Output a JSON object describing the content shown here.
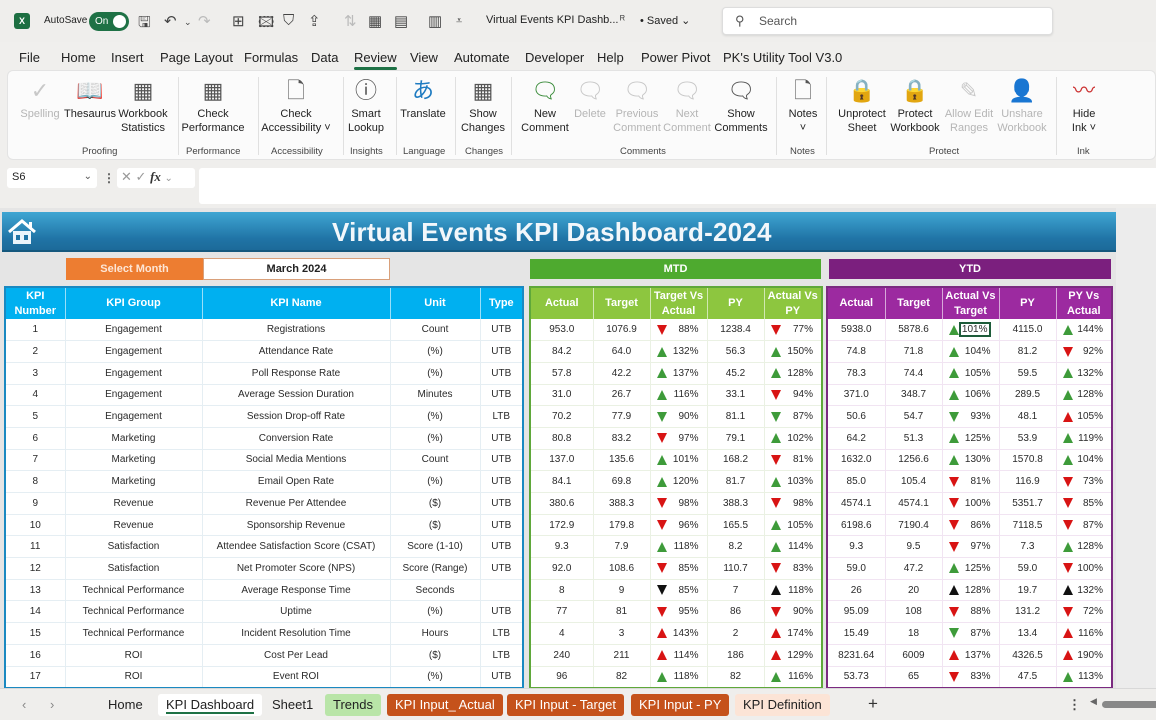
{
  "titlebar": {
    "app_icon": "excel-icon",
    "autosave_label": "AutoSave",
    "autosave_state": "On",
    "doc_title": "Virtual Events KPI Dashb...",
    "saved_status": "• Saved",
    "search_placeholder": "Search"
  },
  "menu": [
    "File",
    "Home",
    "Insert",
    "Page Layout",
    "Formulas",
    "Data",
    "Review",
    "View",
    "Automate",
    "Developer",
    "Help",
    "Power Pivot",
    "PK's Utility Tool V3.0"
  ],
  "menu_active": "Review",
  "ribbon": {
    "buttons": [
      {
        "l1": "Spelling",
        "l2": "",
        "icon": "spelling-icon",
        "disabled": true
      },
      {
        "l1": "Thesaurus",
        "l2": "",
        "icon": "thesaurus-icon",
        "disabled": false
      },
      {
        "l1": "Workbook",
        "l2": "Statistics",
        "icon": "workbook-statistics-icon",
        "disabled": false
      },
      {
        "l1": "Check",
        "l2": "Performance",
        "icon": "check-performance-icon",
        "disabled": false
      },
      {
        "l1": "Check",
        "l2": "Accessibility ˅",
        "icon": "check-accessibility-icon",
        "disabled": false
      },
      {
        "l1": "Smart",
        "l2": "Lookup",
        "icon": "smart-lookup-icon",
        "disabled": false
      },
      {
        "l1": "Translate",
        "l2": "",
        "icon": "translate-icon",
        "disabled": false
      },
      {
        "l1": "Show",
        "l2": "Changes",
        "icon": "show-changes-icon",
        "disabled": false
      },
      {
        "l1": "New",
        "l2": "Comment",
        "icon": "new-comment-icon",
        "disabled": false
      },
      {
        "l1": "Delete",
        "l2": "",
        "icon": "delete-comment-icon",
        "disabled": true
      },
      {
        "l1": "Previous",
        "l2": "Comment",
        "icon": "previous-comment-icon",
        "disabled": true
      },
      {
        "l1": "Next",
        "l2": "Comment",
        "icon": "next-comment-icon",
        "disabled": true
      },
      {
        "l1": "Show",
        "l2": "Comments",
        "icon": "show-comments-icon",
        "disabled": false
      },
      {
        "l1": "Notes",
        "l2": "˅",
        "icon": "notes-icon",
        "disabled": false
      },
      {
        "l1": "Unprotect",
        "l2": "Sheet",
        "icon": "unprotect-sheet-icon",
        "disabled": false
      },
      {
        "l1": "Protect",
        "l2": "Workbook",
        "icon": "protect-workbook-icon",
        "disabled": false
      },
      {
        "l1": "Allow Edit",
        "l2": "Ranges",
        "icon": "allow-edit-ranges-icon",
        "disabled": true
      },
      {
        "l1": "Unshare",
        "l2": "Workbook",
        "icon": "unshare-workbook-icon",
        "disabled": true
      },
      {
        "l1": "Hide",
        "l2": "Ink ˅",
        "icon": "hide-ink-icon",
        "disabled": false
      }
    ],
    "groups": [
      "Proofing",
      "Performance",
      "Accessibility",
      "Insights",
      "Language",
      "Changes",
      "Comments",
      "Notes",
      "Protect",
      "Ink"
    ]
  },
  "formula_bar": {
    "name_box": "S6",
    "formula": ""
  },
  "dashboard": {
    "title": "Virtual Events KPI Dashboard-2024",
    "select_month_label": "Select Month",
    "selected_month": "March 2024",
    "mtd_label": "MTD",
    "ytd_label": "YTD",
    "left_headers": [
      "KPI Number",
      "KPI Group",
      "KPI Name",
      "Unit",
      "Type"
    ],
    "mtd_headers": [
      "Actual",
      "Target",
      "Target Vs Actual",
      "PY",
      "Actual Vs PY"
    ],
    "ytd_headers": [
      "Actual",
      "Target",
      "Actual Vs Target",
      "PY",
      "PY Vs Actual"
    ],
    "colors": {
      "green": "#3e9b3a",
      "red": "#d81414",
      "black": "#111111",
      "banner": "#2074a6",
      "mtd": "#5fa83a",
      "ytd": "#7b2a80",
      "left": "#00b0f0",
      "select": "#ed7d31"
    },
    "rows": [
      {
        "n": "1",
        "group": "Engagement",
        "name": "Registrations",
        "unit": "Count",
        "type": "UTB",
        "mtd": {
          "actual": "953.0",
          "target": "1076.9",
          "tva": {
            "v": "88%",
            "dir": "down",
            "c": "red"
          },
          "py": "1238.4",
          "avp": {
            "v": "77%",
            "dir": "down",
            "c": "red"
          }
        },
        "ytd": {
          "actual": "5938.0",
          "target": "5878.6",
          "avt": {
            "v": "101%",
            "dir": "up",
            "c": "green"
          },
          "py": "4115.0",
          "pva": {
            "v": "144%",
            "dir": "up",
            "c": "green"
          }
        }
      },
      {
        "n": "2",
        "group": "Engagement",
        "name": "Attendance Rate",
        "unit": "(%)",
        "type": "UTB",
        "mtd": {
          "actual": "84.2",
          "target": "64.0",
          "tva": {
            "v": "132%",
            "dir": "up",
            "c": "green"
          },
          "py": "56.3",
          "avp": {
            "v": "150%",
            "dir": "up",
            "c": "green"
          }
        },
        "ytd": {
          "actual": "74.8",
          "target": "71.8",
          "avt": {
            "v": "104%",
            "dir": "up",
            "c": "green"
          },
          "py": "81.2",
          "pva": {
            "v": "92%",
            "dir": "down",
            "c": "red"
          }
        }
      },
      {
        "n": "3",
        "group": "Engagement",
        "name": "Poll Response Rate",
        "unit": "(%)",
        "type": "UTB",
        "mtd": {
          "actual": "57.8",
          "target": "42.2",
          "tva": {
            "v": "137%",
            "dir": "up",
            "c": "green"
          },
          "py": "45.2",
          "avp": {
            "v": "128%",
            "dir": "up",
            "c": "green"
          }
        },
        "ytd": {
          "actual": "78.3",
          "target": "74.4",
          "avt": {
            "v": "105%",
            "dir": "up",
            "c": "green"
          },
          "py": "59.5",
          "pva": {
            "v": "132%",
            "dir": "up",
            "c": "green"
          }
        }
      },
      {
        "n": "4",
        "group": "Engagement",
        "name": "Average Session Duration",
        "unit": "Minutes",
        "type": "UTB",
        "mtd": {
          "actual": "31.0",
          "target": "26.7",
          "tva": {
            "v": "116%",
            "dir": "up",
            "c": "green"
          },
          "py": "33.1",
          "avp": {
            "v": "94%",
            "dir": "down",
            "c": "red"
          }
        },
        "ytd": {
          "actual": "371.0",
          "target": "348.7",
          "avt": {
            "v": "106%",
            "dir": "up",
            "c": "green"
          },
          "py": "289.5",
          "pva": {
            "v": "128%",
            "dir": "up",
            "c": "green"
          }
        }
      },
      {
        "n": "5",
        "group": "Engagement",
        "name": "Session Drop-off Rate",
        "unit": "(%)",
        "type": "LTB",
        "mtd": {
          "actual": "70.2",
          "target": "77.9",
          "tva": {
            "v": "90%",
            "dir": "down",
            "c": "green"
          },
          "py": "81.1",
          "avp": {
            "v": "87%",
            "dir": "down",
            "c": "green"
          }
        },
        "ytd": {
          "actual": "50.6",
          "target": "54.7",
          "avt": {
            "v": "93%",
            "dir": "down",
            "c": "green"
          },
          "py": "48.1",
          "pva": {
            "v": "105%",
            "dir": "up",
            "c": "red"
          }
        }
      },
      {
        "n": "6",
        "group": "Marketing",
        "name": "Conversion Rate",
        "unit": "(%)",
        "type": "UTB",
        "mtd": {
          "actual": "80.8",
          "target": "83.2",
          "tva": {
            "v": "97%",
            "dir": "down",
            "c": "red"
          },
          "py": "79.1",
          "avp": {
            "v": "102%",
            "dir": "up",
            "c": "green"
          }
        },
        "ytd": {
          "actual": "64.2",
          "target": "51.3",
          "avt": {
            "v": "125%",
            "dir": "up",
            "c": "green"
          },
          "py": "53.9",
          "pva": {
            "v": "119%",
            "dir": "up",
            "c": "green"
          }
        }
      },
      {
        "n": "7",
        "group": "Marketing",
        "name": "Social Media Mentions",
        "unit": "Count",
        "type": "UTB",
        "mtd": {
          "actual": "137.0",
          "target": "135.6",
          "tva": {
            "v": "101%",
            "dir": "up",
            "c": "green"
          },
          "py": "168.2",
          "avp": {
            "v": "81%",
            "dir": "down",
            "c": "red"
          }
        },
        "ytd": {
          "actual": "1632.0",
          "target": "1256.6",
          "avt": {
            "v": "130%",
            "dir": "up",
            "c": "green"
          },
          "py": "1570.8",
          "pva": {
            "v": "104%",
            "dir": "up",
            "c": "green"
          }
        }
      },
      {
        "n": "8",
        "group": "Marketing",
        "name": "Email Open Rate",
        "unit": "(%)",
        "type": "UTB",
        "mtd": {
          "actual": "84.1",
          "target": "69.8",
          "tva": {
            "v": "120%",
            "dir": "up",
            "c": "green"
          },
          "py": "81.7",
          "avp": {
            "v": "103%",
            "dir": "up",
            "c": "green"
          }
        },
        "ytd": {
          "actual": "85.0",
          "target": "105.4",
          "avt": {
            "v": "81%",
            "dir": "down",
            "c": "red"
          },
          "py": "116.9",
          "pva": {
            "v": "73%",
            "dir": "down",
            "c": "red"
          }
        }
      },
      {
        "n": "9",
        "group": "Revenue",
        "name": "Revenue Per Attendee",
        "unit": "($)",
        "type": "UTB",
        "mtd": {
          "actual": "380.6",
          "target": "388.3",
          "tva": {
            "v": "98%",
            "dir": "down",
            "c": "red"
          },
          "py": "388.3",
          "avp": {
            "v": "98%",
            "dir": "down",
            "c": "red"
          }
        },
        "ytd": {
          "actual": "4574.1",
          "target": "4574.1",
          "avt": {
            "v": "100%",
            "dir": "down",
            "c": "red"
          },
          "py": "5351.7",
          "pva": {
            "v": "85%",
            "dir": "down",
            "c": "red"
          }
        }
      },
      {
        "n": "10",
        "group": "Revenue",
        "name": "Sponsorship Revenue",
        "unit": "($)",
        "type": "UTB",
        "mtd": {
          "actual": "172.9",
          "target": "179.8",
          "tva": {
            "v": "96%",
            "dir": "down",
            "c": "red"
          },
          "py": "165.5",
          "avp": {
            "v": "105%",
            "dir": "up",
            "c": "green"
          }
        },
        "ytd": {
          "actual": "6198.6",
          "target": "7190.4",
          "avt": {
            "v": "86%",
            "dir": "down",
            "c": "red"
          },
          "py": "7118.5",
          "pva": {
            "v": "87%",
            "dir": "down",
            "c": "red"
          }
        }
      },
      {
        "n": "11",
        "group": "Satisfaction",
        "name": "Attendee Satisfaction Score (CSAT)",
        "unit": "Score (1-10)",
        "type": "UTB",
        "mtd": {
          "actual": "9.3",
          "target": "7.9",
          "tva": {
            "v": "118%",
            "dir": "up",
            "c": "green"
          },
          "py": "8.2",
          "avp": {
            "v": "114%",
            "dir": "up",
            "c": "green"
          }
        },
        "ytd": {
          "actual": "9.3",
          "target": "9.5",
          "avt": {
            "v": "97%",
            "dir": "down",
            "c": "red"
          },
          "py": "7.3",
          "pva": {
            "v": "128%",
            "dir": "up",
            "c": "green"
          }
        }
      },
      {
        "n": "12",
        "group": "Satisfaction",
        "name": "Net Promoter Score (NPS)",
        "unit": "Score (Range)",
        "type": "UTB",
        "mtd": {
          "actual": "92.0",
          "target": "108.6",
          "tva": {
            "v": "85%",
            "dir": "down",
            "c": "red"
          },
          "py": "110.7",
          "avp": {
            "v": "83%",
            "dir": "down",
            "c": "red"
          }
        },
        "ytd": {
          "actual": "59.0",
          "target": "47.2",
          "avt": {
            "v": "125%",
            "dir": "up",
            "c": "green"
          },
          "py": "59.0",
          "pva": {
            "v": "100%",
            "dir": "down",
            "c": "red"
          }
        }
      },
      {
        "n": "13",
        "group": "Technical Performance",
        "name": "Average Response Time",
        "unit": "Seconds",
        "type": "",
        "mtd": {
          "actual": "8",
          "target": "9",
          "tva": {
            "v": "85%",
            "dir": "down",
            "c": "black"
          },
          "py": "7",
          "avp": {
            "v": "118%",
            "dir": "up",
            "c": "black"
          }
        },
        "ytd": {
          "actual": "26",
          "target": "20",
          "avt": {
            "v": "128%",
            "dir": "up",
            "c": "black"
          },
          "py": "19.7",
          "pva": {
            "v": "132%",
            "dir": "up",
            "c": "black"
          }
        }
      },
      {
        "n": "14",
        "group": "Technical Performance",
        "name": "Uptime",
        "unit": "(%)",
        "type": "UTB",
        "mtd": {
          "actual": "77",
          "target": "81",
          "tva": {
            "v": "95%",
            "dir": "down",
            "c": "red"
          },
          "py": "86",
          "avp": {
            "v": "90%",
            "dir": "down",
            "c": "red"
          }
        },
        "ytd": {
          "actual": "95.09",
          "target": "108",
          "avt": {
            "v": "88%",
            "dir": "down",
            "c": "red"
          },
          "py": "131.2",
          "pva": {
            "v": "72%",
            "dir": "down",
            "c": "red"
          }
        }
      },
      {
        "n": "15",
        "group": "Technical Performance",
        "name": "Incident Resolution Time",
        "unit": "Hours",
        "type": "LTB",
        "mtd": {
          "actual": "4",
          "target": "3",
          "tva": {
            "v": "143%",
            "dir": "up",
            "c": "red"
          },
          "py": "2",
          "avp": {
            "v": "174%",
            "dir": "up",
            "c": "red"
          }
        },
        "ytd": {
          "actual": "15.49",
          "target": "18",
          "avt": {
            "v": "87%",
            "dir": "down",
            "c": "green"
          },
          "py": "13.4",
          "pva": {
            "v": "116%",
            "dir": "up",
            "c": "red"
          }
        }
      },
      {
        "n": "16",
        "group": "ROI",
        "name": "Cost Per Lead",
        "unit": "($)",
        "type": "LTB",
        "mtd": {
          "actual": "240",
          "target": "211",
          "tva": {
            "v": "114%",
            "dir": "up",
            "c": "red"
          },
          "py": "186",
          "avp": {
            "v": "129%",
            "dir": "up",
            "c": "red"
          }
        },
        "ytd": {
          "actual": "8231.64",
          "target": "6009",
          "avt": {
            "v": "137%",
            "dir": "up",
            "c": "red"
          },
          "py": "4326.5",
          "pva": {
            "v": "190%",
            "dir": "up",
            "c": "red"
          }
        }
      },
      {
        "n": "17",
        "group": "ROI",
        "name": "Event ROI",
        "unit": "(%)",
        "type": "UTB",
        "mtd": {
          "actual": "96",
          "target": "82",
          "tva": {
            "v": "118%",
            "dir": "up",
            "c": "green"
          },
          "py": "82",
          "avp": {
            "v": "116%",
            "dir": "up",
            "c": "green"
          }
        },
        "ytd": {
          "actual": "53.73",
          "target": "65",
          "avt": {
            "v": "83%",
            "dir": "down",
            "c": "red"
          },
          "py": "47.5",
          "pva": {
            "v": "113%",
            "dir": "up",
            "c": "green"
          }
        }
      }
    ]
  },
  "sheet_tabs": [
    {
      "label": "Home",
      "style": "plain"
    },
    {
      "label": "KPI Dashboard",
      "style": "active"
    },
    {
      "label": "Sheet1",
      "style": "plain"
    },
    {
      "label": "Trends",
      "style": "green"
    },
    {
      "label": "KPI Input_ Actual",
      "style": "orange"
    },
    {
      "label": "KPI Input - Target",
      "style": "orange"
    },
    {
      "label": "KPI Input - PY",
      "style": "orange"
    },
    {
      "label": "KPI Definition",
      "style": "peach"
    }
  ],
  "add_sheet_label": "+"
}
